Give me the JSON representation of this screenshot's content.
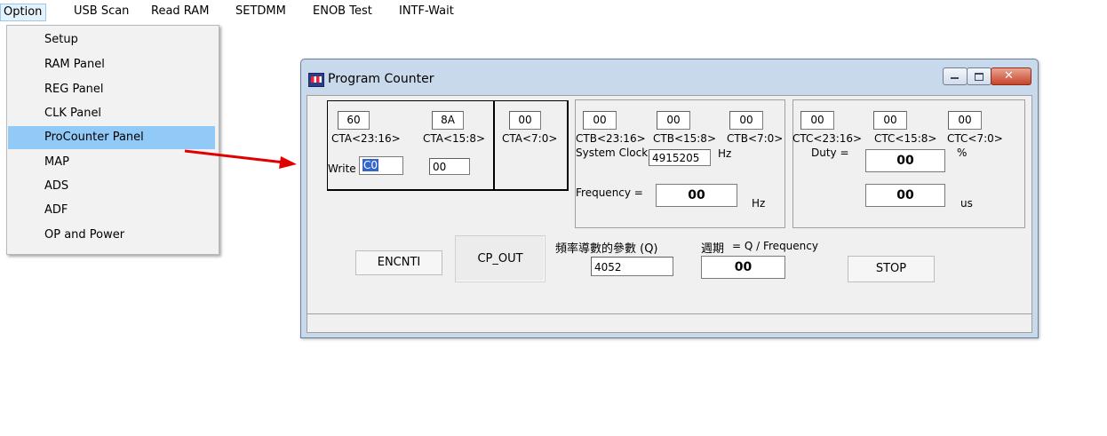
{
  "menubar": {
    "items": [
      "Option",
      "USB Scan",
      "Read RAM",
      "SETDMM",
      "ENOB Test",
      "INTF-Wait"
    ]
  },
  "dropdown": {
    "items": [
      "Setup",
      "RAM Panel",
      "REG Panel",
      "CLK Panel",
      "ProCounter Panel",
      "MAP",
      "ADS",
      "ADF",
      "OP and Power"
    ],
    "selected": "ProCounter Panel"
  },
  "window": {
    "title": "Program Counter",
    "close_glyph": "✕"
  },
  "cta": {
    "hi_value": "60",
    "hi_label": "CTA<23:16>",
    "mid_value": "8A",
    "mid_label": "CTA<15:8>",
    "lo_value": "00",
    "lo_label": "CTA<7:0>",
    "write_label": "Write",
    "write_value": "C0",
    "write_value2": "00"
  },
  "ctb": {
    "hi_value": "00",
    "hi_label": "CTB<23:16>",
    "mid_value": "00",
    "mid_label": "CTB<15:8>",
    "lo_value": "00",
    "lo_label": "CTB<7:0>",
    "system_clock_label": "System Clock",
    "system_clock_value": "4915205",
    "system_clock_unit": "Hz",
    "frequency_label": "Frequency =",
    "frequency_value": "00",
    "frequency_unit": "Hz"
  },
  "ctc": {
    "hi_value": "00",
    "hi_label": "CTC<23:16>",
    "mid_value": "00",
    "mid_label": "CTC<15:8>",
    "lo_value": "00",
    "lo_label": "CTC<7:0>",
    "duty_label": "Duty =",
    "duty_value": "00",
    "duty_unit": "%",
    "period_value": "00",
    "period_unit": "us"
  },
  "controls": {
    "encnti_label": "ENCNTI",
    "cp_out_label": "CP_OUT",
    "q_label": "頻率導數的參數 (Q)",
    "q_value": "4052",
    "period_label_cn": "週期",
    "period_formula": "= Q / Frequency",
    "period_value": "00",
    "stop_label": "STOP"
  },
  "colors": {
    "menu_highlight": "#91c9f7",
    "arrow": "#e00000"
  }
}
